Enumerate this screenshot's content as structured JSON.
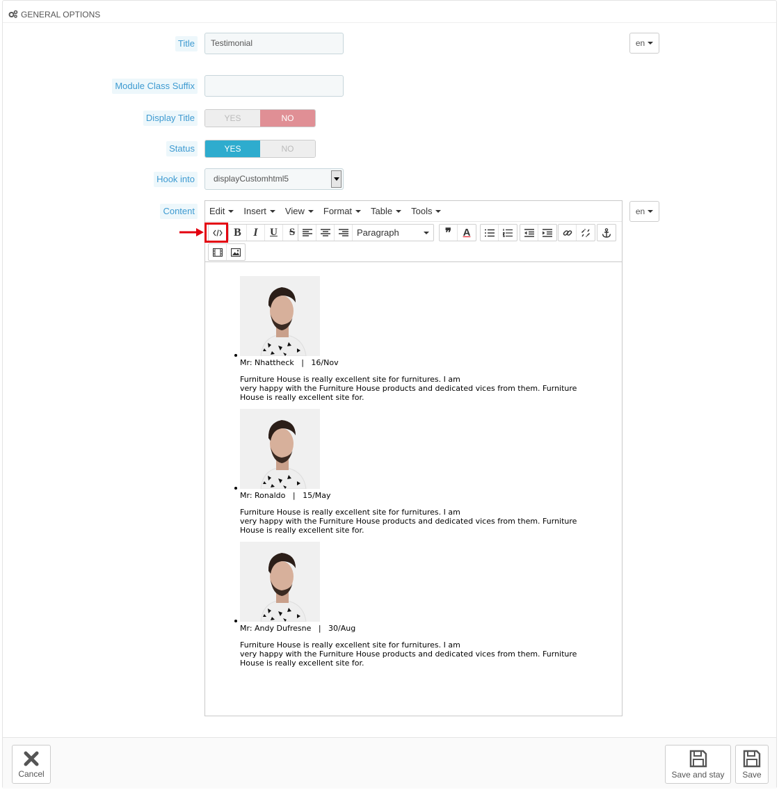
{
  "panel": {
    "heading": "GENERAL OPTIONS"
  },
  "fields": {
    "title_label": "Title",
    "title_value": "Testimonial",
    "suffix_label": "Module Class Suffix",
    "suffix_value": "",
    "display_title_label": "Display Title",
    "status_label": "Status",
    "hook_label": "Hook into",
    "hook_value": "displayCustomhtml5",
    "content_label": "Content"
  },
  "switches": {
    "display_title": {
      "yes": "YES",
      "no": "NO",
      "selected": "NO"
    },
    "status": {
      "yes": "YES",
      "no": "NO",
      "selected": "YES"
    }
  },
  "lang": {
    "title": "en",
    "content": "en"
  },
  "editor": {
    "menus": [
      "Edit",
      "Insert",
      "View",
      "Format",
      "Table",
      "Tools"
    ],
    "block_format": "Paragraph",
    "toolbar_icons": [
      "source-code-icon",
      "bold-icon",
      "italic-icon",
      "underline-icon",
      "strikethrough-icon",
      "align-left-icon",
      "align-center-icon",
      "align-right-icon",
      "blockquote-icon",
      "text-color-icon",
      "bullet-list-icon",
      "numbered-list-icon",
      "outdent-icon",
      "indent-icon",
      "link-icon",
      "unlink-icon",
      "anchor-icon",
      "media-icon",
      "image-icon"
    ],
    "bold_glyph": "B",
    "italic_glyph": "I",
    "underline_glyph": "U",
    "strike_glyph": "S",
    "textcolor_glyph": "A",
    "quote_glyph": "❞"
  },
  "testimonials": [
    {
      "meta": "Mr: Nhattheck   |   16/Nov",
      "text1": "Furniture House is really excellent site for furnitures. I am",
      "text2": "very happy with the Furniture House products and dedicated vices from them. Furniture",
      "text3": "House is really excellent site for."
    },
    {
      "meta": "Mr: Ronaldo   |   15/May",
      "text1": "Furniture House is really excellent site for furnitures. I am",
      "text2": "very happy with the Furniture House products and dedicated vices from them. Furniture",
      "text3": "House is really excellent site for."
    },
    {
      "meta": "Mr: Andy Dufresne   |   30/Aug",
      "text1": "Furniture House is really excellent site for furnitures. I am",
      "text2": "very happy with the Furniture House products and dedicated vices from them. Furniture",
      "text3": "House is really excellent site for."
    }
  ],
  "footer": {
    "cancel": "Cancel",
    "save_and_stay": "Save and stay",
    "save": "Save"
  }
}
